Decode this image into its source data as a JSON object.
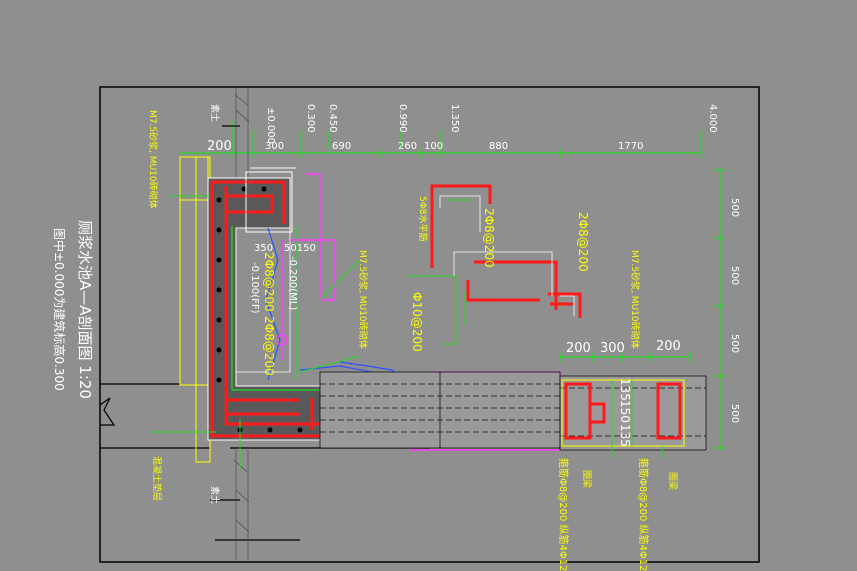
{
  "title": "厕浆水池A—A剖面图 1:20",
  "subtitle": "图中±0.000为建筑标高0.300",
  "elevations": [
    "±0.000",
    "0.300",
    "0.450",
    "0.990",
    "1.350",
    "4.000"
  ],
  "top_dimensions": [
    "200",
    "300",
    "690",
    "260",
    "100",
    "880",
    "1770"
  ],
  "right_dimensions": [
    "500",
    "500",
    "500",
    "500"
  ],
  "beam_dimensions": [
    "200",
    "300",
    "200"
  ],
  "beam_detail_dims": [
    "135",
    "150",
    "135"
  ],
  "pipe_dims": [
    "350",
    "50150"
  ],
  "levels": [
    "-0.100(FF)",
    "-0.200(ML)"
  ],
  "wall_notes": [
    "M7.5砂浆, MU10砖砌体",
    "M7.5砂浆, MU10砖砌体",
    "M7.5砂浆, MU10砖砌体"
  ],
  "rebar_labels": [
    "2Φ8@200",
    "2Φ8@200",
    "Φ10@200",
    "2Φ8@200",
    "2Φ8@200"
  ],
  "rebar_callout": "5Φ8水平筋",
  "stirrup_notes": [
    "箍筋Φ8@200 纵筋4Φ12",
    "箍筋Φ8@200 纵筋4Φ12"
  ],
  "beam_tags": [
    "圈梁",
    "圈梁"
  ],
  "side_notes": [
    "混凝土垫层"
  ],
  "soil_labels": [
    "素土",
    "素土"
  ],
  "colors": {
    "background": "#8f8f8f",
    "frame": "#000000",
    "rebar": "#ff1a1a",
    "dimension": "#22dd22",
    "text": "#ffff00",
    "outline": "#ffffff",
    "pipe": "#ff3bff",
    "blue": "#3050ff"
  }
}
